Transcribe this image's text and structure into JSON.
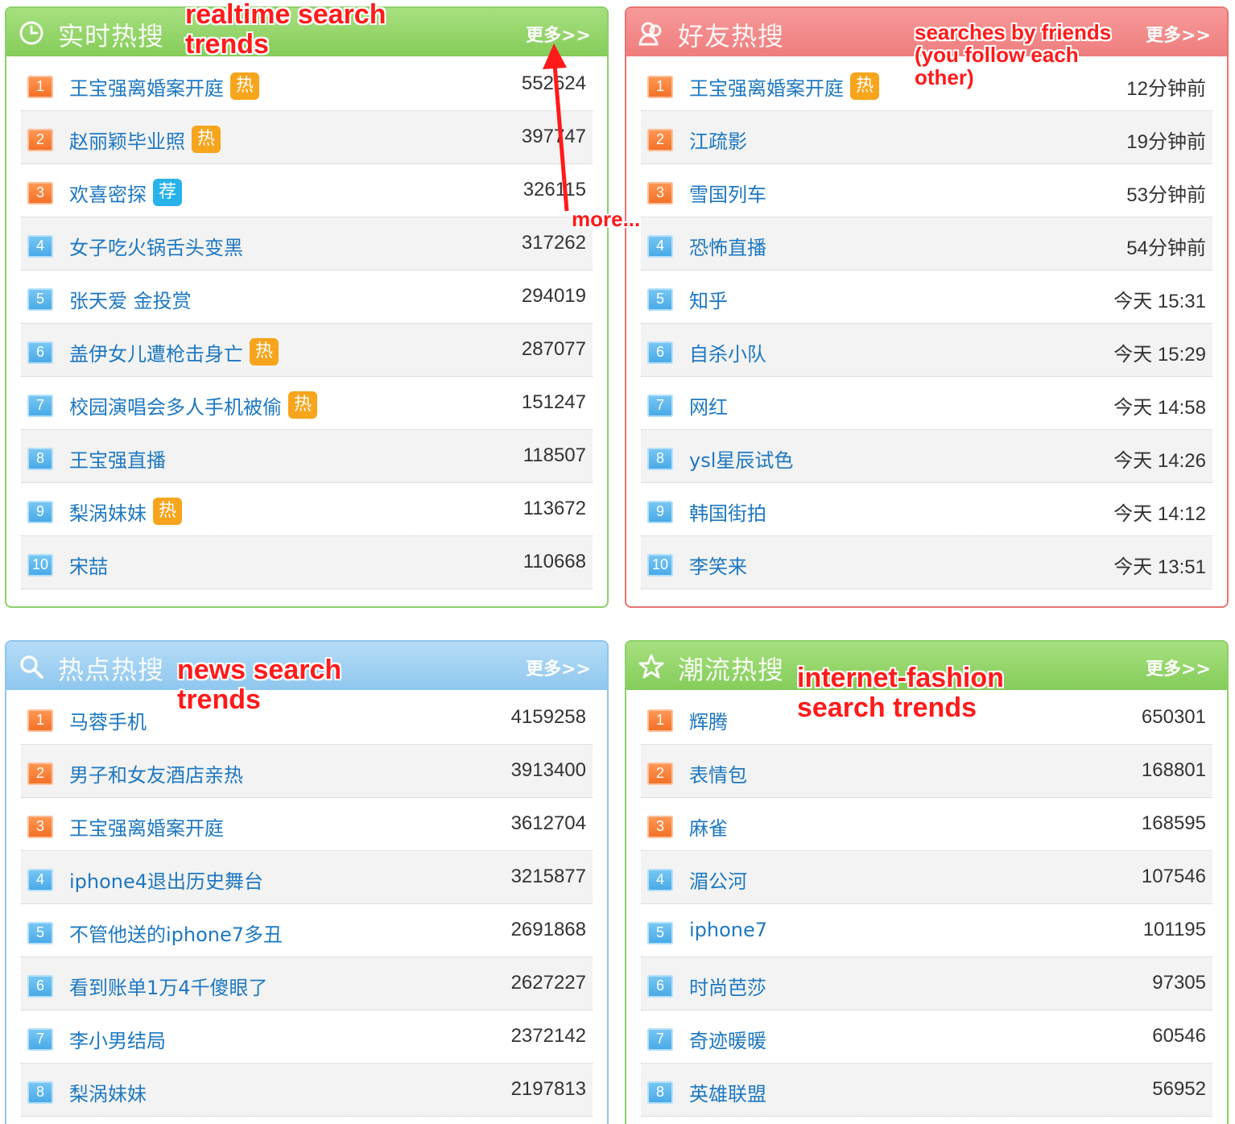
{
  "more_label": "更多>>",
  "colors": {
    "green": "#85cc5a",
    "red": "#ef7d7d",
    "blue": "#8fc7ee",
    "link": "#1d78c2",
    "annotation": "#ff1a1a"
  },
  "realtime": {
    "title": "实时热搜",
    "icon": "clock-icon",
    "rows": [
      {
        "rank": "1",
        "term": "王宝强离婚案开庭",
        "tag": "热",
        "value": "552624"
      },
      {
        "rank": "2",
        "term": "赵丽颖毕业照",
        "tag": "热",
        "value": "397747"
      },
      {
        "rank": "3",
        "term": "欢喜密探",
        "tag": "荐",
        "value": "326115"
      },
      {
        "rank": "4",
        "term": "女子吃火锅舌头变黑",
        "tag": "",
        "value": "317262"
      },
      {
        "rank": "5",
        "term": "张天爱 金投赏",
        "tag": "",
        "value": "294019"
      },
      {
        "rank": "6",
        "term": "盖伊女儿遭枪击身亡",
        "tag": "热",
        "value": "287077"
      },
      {
        "rank": "7",
        "term": "校园演唱会多人手机被偷",
        "tag": "热",
        "value": "151247"
      },
      {
        "rank": "8",
        "term": "王宝强直播",
        "tag": "",
        "value": "118507"
      },
      {
        "rank": "9",
        "term": "梨涡妹妹",
        "tag": "热",
        "value": "113672"
      },
      {
        "rank": "10",
        "term": "宋喆",
        "tag": "",
        "value": "110668"
      }
    ]
  },
  "friends": {
    "title": "好友热搜",
    "icon": "friends-icon",
    "rows": [
      {
        "rank": "1",
        "term": "王宝强离婚案开庭",
        "tag": "热",
        "value": "12分钟前"
      },
      {
        "rank": "2",
        "term": "江疏影",
        "tag": "",
        "value": "19分钟前"
      },
      {
        "rank": "3",
        "term": "雪国列车",
        "tag": "",
        "value": "53分钟前"
      },
      {
        "rank": "4",
        "term": "恐怖直播",
        "tag": "",
        "value": "54分钟前"
      },
      {
        "rank": "5",
        "term": "知乎",
        "tag": "",
        "value": "今天 15:31"
      },
      {
        "rank": "6",
        "term": "自杀小队",
        "tag": "",
        "value": "今天 15:29"
      },
      {
        "rank": "7",
        "term": "网红",
        "tag": "",
        "value": "今天 14:58"
      },
      {
        "rank": "8",
        "term": "ysl星辰试色",
        "tag": "",
        "value": "今天 14:26"
      },
      {
        "rank": "9",
        "term": "韩国街拍",
        "tag": "",
        "value": "今天 14:12"
      },
      {
        "rank": "10",
        "term": "李笑来",
        "tag": "",
        "value": "今天 13:51"
      }
    ]
  },
  "news": {
    "title": "热点热搜",
    "icon": "search-icon",
    "rows": [
      {
        "rank": "1",
        "term": "马蓉手机",
        "tag": "",
        "value": "4159258"
      },
      {
        "rank": "2",
        "term": "男子和女友酒店亲热",
        "tag": "",
        "value": "3913400"
      },
      {
        "rank": "3",
        "term": "王宝强离婚案开庭",
        "tag": "",
        "value": "3612704"
      },
      {
        "rank": "4",
        "term": "iphone4退出历史舞台",
        "tag": "",
        "value": "3215877"
      },
      {
        "rank": "5",
        "term": "不管他送的iphone7多丑",
        "tag": "",
        "value": "2691868"
      },
      {
        "rank": "6",
        "term": "看到账单1万4千傻眼了",
        "tag": "",
        "value": "2627227"
      },
      {
        "rank": "7",
        "term": "李小男结局",
        "tag": "",
        "value": "2372142"
      },
      {
        "rank": "8",
        "term": "梨涡妹妹",
        "tag": "",
        "value": "2197813"
      }
    ]
  },
  "fashion": {
    "title": "潮流热搜",
    "icon": "star-icon",
    "rows": [
      {
        "rank": "1",
        "term": "辉腾",
        "tag": "",
        "value": "650301"
      },
      {
        "rank": "2",
        "term": "表情包",
        "tag": "",
        "value": "168801"
      },
      {
        "rank": "3",
        "term": "麻雀",
        "tag": "",
        "value": "168595"
      },
      {
        "rank": "4",
        "term": "湄公河",
        "tag": "",
        "value": "107546"
      },
      {
        "rank": "5",
        "term": "iphone7",
        "tag": "",
        "value": "101195"
      },
      {
        "rank": "6",
        "term": "时尚芭莎",
        "tag": "",
        "value": "97305"
      },
      {
        "rank": "7",
        "term": "奇迹暖暖",
        "tag": "",
        "value": "60546"
      },
      {
        "rank": "8",
        "term": "英雄联盟",
        "tag": "",
        "value": "56952"
      }
    ]
  },
  "annotations": {
    "realtime": [
      "realtime search",
      "trends"
    ],
    "friends": [
      "searches by friends",
      "(you follow each",
      "other)"
    ],
    "news": [
      "news search",
      "trends"
    ],
    "fashion": [
      "internet-fashion",
      "search trends"
    ],
    "more": "more..."
  }
}
